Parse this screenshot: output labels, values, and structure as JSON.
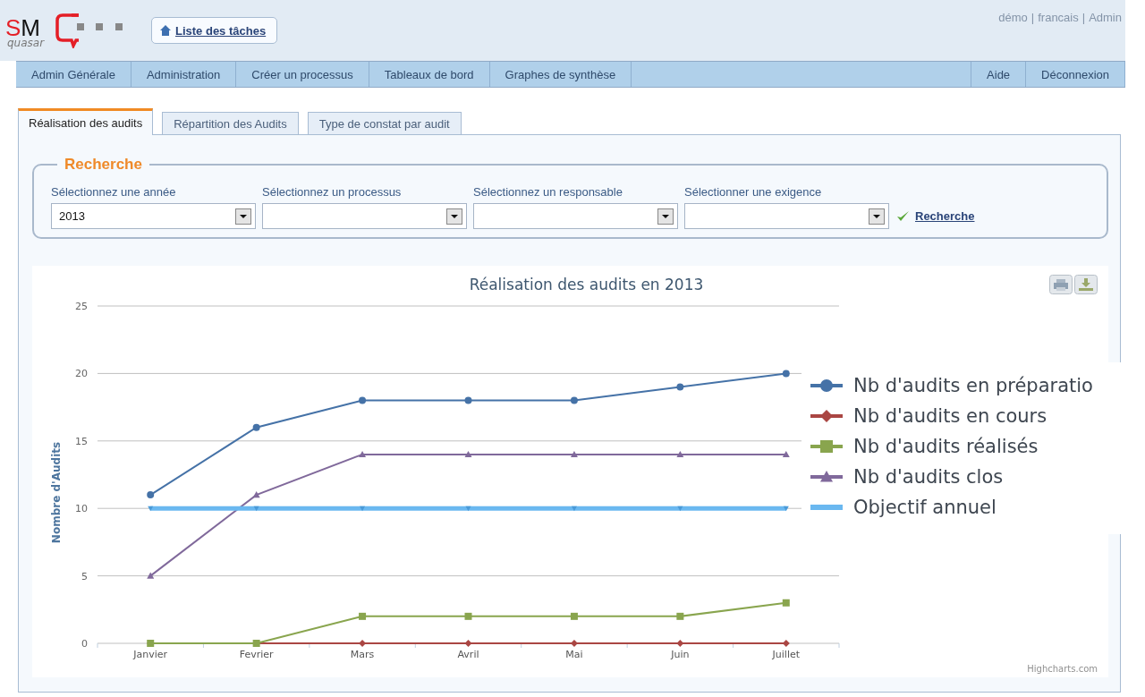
{
  "header": {
    "logo": {
      "title": "SM",
      "subtitle": "quasar"
    },
    "task_button": "Liste des tâches",
    "user_links": [
      "démo",
      "francais",
      "Admin"
    ],
    "separator": "|"
  },
  "menu": {
    "left": [
      "Admin Générale",
      "Administration",
      "Créer un processus",
      "Tableaux de bord",
      "Graphes de synthèse"
    ],
    "right": [
      "Aide",
      "Déconnexion"
    ]
  },
  "tabs": [
    {
      "label": "Réalisation des audits",
      "selected": true
    },
    {
      "label": "Répartition des Audits",
      "selected": false
    },
    {
      "label": "Type de constat par audit",
      "selected": false
    }
  ],
  "search": {
    "legend": "Recherche",
    "fields": [
      {
        "label": "Sélectionnez une année",
        "value": "2013"
      },
      {
        "label": "Sélectionnez un processus"
      },
      {
        "label": "Sélectionnez un responsable"
      },
      {
        "label": "Sélectionner une exigence"
      }
    ],
    "submit": "Recherche"
  },
  "chart": {
    "credit": "Highcharts.com",
    "chart_data": {
      "type": "line",
      "title": "Réalisation des audits en 2013",
      "ylabel": "Nombre d'Audits",
      "categories": [
        "Janvier",
        "Fevrier",
        "Mars",
        "Avril",
        "Mai",
        "Juin",
        "Juillet"
      ],
      "ylim": [
        0,
        25
      ],
      "grid": true,
      "yticks": [
        0,
        5,
        10,
        15,
        20,
        25
      ],
      "series": [
        {
          "name": "Nb d'audits en préparatio",
          "color": "#4572a7",
          "marker": "circle",
          "values": [
            11,
            16,
            18,
            18,
            18,
            19,
            20
          ]
        },
        {
          "name": "Nb d'audits en cours",
          "color": "#aa4643",
          "marker": "diamond",
          "values": [
            0,
            0,
            0,
            0,
            0,
            0,
            0
          ]
        },
        {
          "name": "Nb d'audits réalisés",
          "color": "#89a54e",
          "marker": "square",
          "values": [
            0,
            0,
            2,
            2,
            2,
            2,
            3
          ]
        },
        {
          "name": "Nb d'audits clos",
          "color": "#80699b",
          "marker": "triangle",
          "values": [
            5,
            11,
            14,
            14,
            14,
            14,
            14
          ]
        },
        {
          "name": "Objectif annuel",
          "color": "#6ab8f0",
          "marker": "triangle-down",
          "values": [
            10,
            10,
            10,
            10,
            10,
            10,
            10
          ]
        }
      ]
    }
  }
}
